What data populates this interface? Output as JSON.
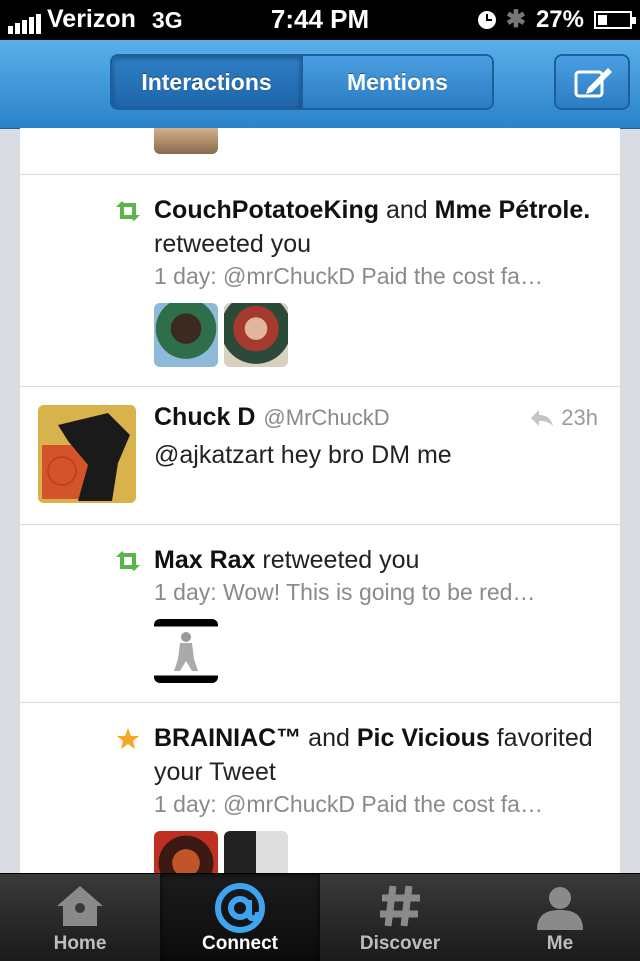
{
  "status_bar": {
    "carrier": "Verizon",
    "network": "3G",
    "time": "7:44 PM",
    "battery": "27%",
    "battery_level": 0.27
  },
  "nav": {
    "segments": [
      "Interactions",
      "Mentions"
    ],
    "selected_segment": "Interactions",
    "compose_icon": "compose-icon"
  },
  "feed": [
    {
      "type": "retweet",
      "actor1": "CouchPotatoeKing",
      "connector": "and",
      "actor2": "Mme Pétrole.",
      "action": "retweeted you",
      "excerpt": "1 day: @mrChuckD Paid the cost fa…"
    },
    {
      "type": "tweet",
      "name": "Chuck D",
      "handle": "@MrChuckD",
      "time": "23h",
      "text": "@ajkatzart hey bro DM me"
    },
    {
      "type": "retweet",
      "actor1": "Max Rax",
      "action": "retweeted you",
      "excerpt": "1 day: Wow!  This is going to be red…"
    },
    {
      "type": "favorite",
      "actor1": "BRAINIAC™",
      "connector": "and",
      "actor2": "Pic Vicious",
      "action": "favorited your Tweet",
      "excerpt": "1 day: @mrChuckD Paid the cost fa…"
    }
  ],
  "tabbar": {
    "tabs": [
      "Home",
      "Connect",
      "Discover",
      "Me"
    ],
    "active": "Connect"
  },
  "colors": {
    "retweet_green": "#5bb64a",
    "favorite_orange": "#f5a623",
    "nav_blue": "#2b82c8"
  }
}
